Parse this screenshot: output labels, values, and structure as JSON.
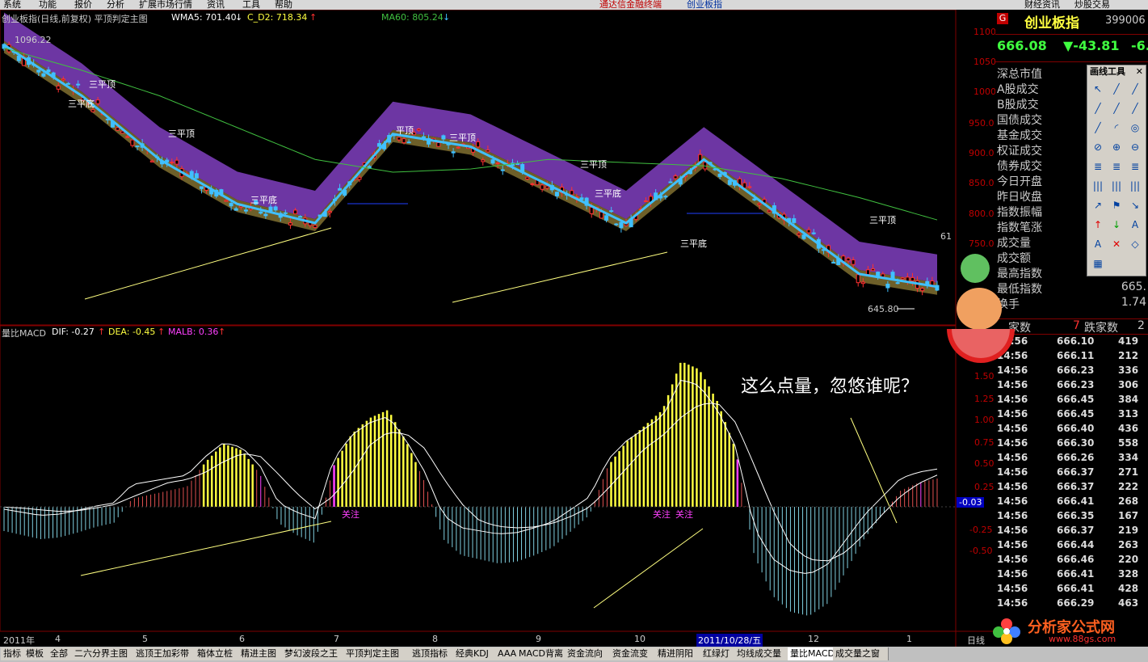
{
  "menu": {
    "items": [
      "系统",
      "功能",
      "报价",
      "分析",
      "扩展市场行情",
      "资讯",
      "工具",
      "帮助"
    ],
    "center_text": "通达信金融终端",
    "center_sub": "创业板指",
    "right_button": "财经资讯",
    "right_button2": "炒股交易"
  },
  "main_chart": {
    "title": "创业板指(日线,前复权) 平顶判定主图",
    "wma5_label": "WMA5: 701.40",
    "wma5_arrow": "↓",
    "cd2_label": "C_D2: 718.34",
    "cd2_arrow": "↑",
    "ma60_label": "MA60: 805.24",
    "ma60_arrow": "↓",
    "high_label": "1096.22",
    "low_label": "645.80",
    "right_mark": "61",
    "annotations": [
      "三平底",
      "三平顶",
      "三平顶",
      "三平底",
      "平顶",
      "三平顶",
      "三平顶",
      "三平底",
      "三平底",
      "三平顶"
    ],
    "yticks": [
      "1100",
      "1050",
      "1000",
      "950.0",
      "900.0",
      "850.0",
      "800.0",
      "750.0"
    ]
  },
  "chart_data": {
    "type": "line",
    "x": [
      "2011年",
      "4",
      "5",
      "6",
      "7",
      "8",
      "9",
      "10",
      "2011/10/28/五",
      "12",
      "1"
    ],
    "series": [
      {
        "name": "WMA5",
        "values": [
          1080,
          1000,
          900,
          830,
          800,
          940,
          920,
          860,
          800,
          900,
          810,
          720,
          700
        ]
      },
      {
        "name": "MA60",
        "values": [
          1075,
          1040,
          1000,
          950,
          900,
          880,
          885,
          900,
          895,
          890,
          870,
          840,
          805
        ]
      }
    ],
    "ylim": [
      640,
      1120
    ]
  },
  "macd_chart": {
    "title": "量比MACD",
    "dif_label": "DIF: -0.27",
    "dif_arrow": "↑",
    "dea_label": "DEA: -0.45",
    "dea_arrow": "↑",
    "malb_label": "MALB: 0.36",
    "malb_arrow": "↑",
    "comment": "这么点量，忽悠谁呢？",
    "focus_labels": [
      "关注",
      "关注",
      "关注"
    ],
    "current_value": "-0.03",
    "yticks": [
      "1.50",
      "1.25",
      "1.00",
      "0.75",
      "0.50",
      "0.25",
      "-0.25",
      "-0.50"
    ],
    "histogram": [
      -0.3,
      -0.35,
      -0.4,
      -0.38,
      -0.32,
      -0.25,
      -0.2,
      0.1,
      0.15,
      0.2,
      0.25,
      0.55,
      0.78,
      0.7,
      0.4,
      -0.2,
      -0.35,
      -0.45,
      0.5,
      0.9,
      1.1,
      1.2,
      0.8,
      0.3,
      -0.4,
      -0.6,
      -0.65,
      -0.7,
      -0.68,
      -0.6,
      -0.5,
      -0.3,
      -0.1,
      0.5,
      0.8,
      1.0,
      1.2,
      1.8,
      1.7,
      1.3,
      0.7,
      -0.6,
      -1.1,
      -1.3,
      -1.35,
      -1.2,
      -0.8,
      -0.4,
      -0.1,
      0.2,
      0.3,
      0.35
    ]
  },
  "xaxis": {
    "labels": [
      "2011年",
      "4",
      "5",
      "6",
      "7",
      "8",
      "9",
      "10",
      "2011/10/28/五",
      "12",
      "1"
    ],
    "right_label": "日线"
  },
  "quote_panel": {
    "name": "创业板指",
    "code": "399006",
    "price": "666.08",
    "change": "▼-43.81",
    "change_pct": "-6.",
    "fields": [
      "深总市值",
      "A股成交",
      "B股成交",
      "国债成交",
      "基金成交",
      "权证成交",
      "债券成交",
      "今日开盘",
      "昨日收盘",
      "指数振幅",
      "指数笔涨",
      "成交量",
      "成交额",
      "最高指数",
      "最低指数",
      "换手"
    ],
    "field_values": [
      "",
      "",
      "",
      "",
      "",
      "",
      "",
      "",
      "",
      "",
      "",
      "",
      "",
      "",
      "665.",
      "1.74"
    ],
    "up_count_label": "家数",
    "down_count": "7",
    "down_label": "跌家数",
    "down_value": "2"
  },
  "tick_table": [
    {
      "t": "14:56",
      "p": "666.10",
      "v": "419"
    },
    {
      "t": "14:56",
      "p": "666.11",
      "v": "212"
    },
    {
      "t": "14:56",
      "p": "666.23",
      "v": "336"
    },
    {
      "t": "14:56",
      "p": "666.23",
      "v": "306"
    },
    {
      "t": "14:56",
      "p": "666.45",
      "v": "384"
    },
    {
      "t": "14:56",
      "p": "666.45",
      "v": "313"
    },
    {
      "t": "14:56",
      "p": "666.40",
      "v": "436"
    },
    {
      "t": "14:56",
      "p": "666.30",
      "v": "558"
    },
    {
      "t": "14:56",
      "p": "666.26",
      "v": "334"
    },
    {
      "t": "14:56",
      "p": "666.37",
      "v": "271"
    },
    {
      "t": "14:56",
      "p": "666.37",
      "v": "222"
    },
    {
      "t": "14:56",
      "p": "666.41",
      "v": "268"
    },
    {
      "t": "14:56",
      "p": "666.35",
      "v": "167"
    },
    {
      "t": "14:56",
      "p": "666.37",
      "v": "219"
    },
    {
      "t": "14:56",
      "p": "666.44",
      "v": "263"
    },
    {
      "t": "14:56",
      "p": "666.46",
      "v": "220"
    },
    {
      "t": "14:56",
      "p": "666.41",
      "v": "328"
    },
    {
      "t": "14:56",
      "p": "666.41",
      "v": "428"
    },
    {
      "t": "14:56",
      "p": "666.29",
      "v": "463"
    }
  ],
  "drawing_tools": {
    "title": "画线工具",
    "close": "✕"
  },
  "watermark": {
    "site": "分析家公式网",
    "url": "www.88gs.com"
  },
  "bottom_tabs": [
    "指标",
    "模板",
    "全部",
    "二六分界主图",
    "逃顶王加彩带",
    "箱体立桩",
    "精进主图",
    "梦幻波段之王",
    "平顶判定主图",
    "逃顶指标",
    "经典KDJ",
    "AAA",
    "MACD背离",
    "资金流向",
    "资金流变",
    "精进阴阳",
    "红绿灯",
    "均线成交量",
    "量比MACD",
    "成交量之窗"
  ],
  "active_tab": "量比MACD",
  "colors": {
    "up": "#ff3030",
    "down": "#40c0ff",
    "ma60": "#40c040",
    "macd_yellow": "#ffff40",
    "purple": "#8040c0"
  }
}
